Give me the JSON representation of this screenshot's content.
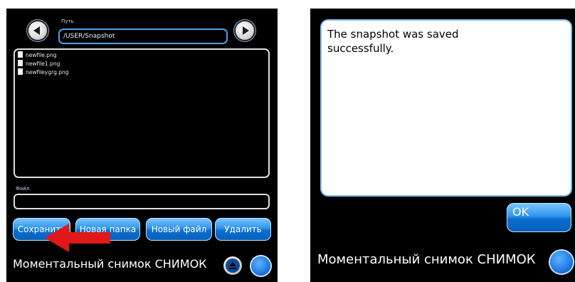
{
  "file_browser": {
    "path_label": "Путь",
    "path_value": "/USER/Snapshot",
    "files": [
      {
        "name": "newfile.png"
      },
      {
        "name": "newfile1.png"
      },
      {
        "name": "newfileygrg.png"
      }
    ],
    "file_label": "Файл",
    "file_value": "",
    "buttons": {
      "save": "Сохранить",
      "new_folder": "Новая папка",
      "new_file": "Новый файл",
      "delete": "Удалить"
    },
    "status_text": "Моментальный снимок СНИМОК"
  },
  "dialog": {
    "message": "The snapshot was saved successfully.",
    "ok_label": "OK",
    "status_text": "Моментальный снимок СНИМОК"
  },
  "icons": {
    "back": "arrow-left-icon",
    "forward": "arrow-right-icon",
    "collapse": "eject-icon",
    "callout": "red-arrow-icon"
  },
  "colors": {
    "accent_blue": "#1f8ae8",
    "callout_red": "#e01818",
    "panel_bg": "#000000"
  }
}
